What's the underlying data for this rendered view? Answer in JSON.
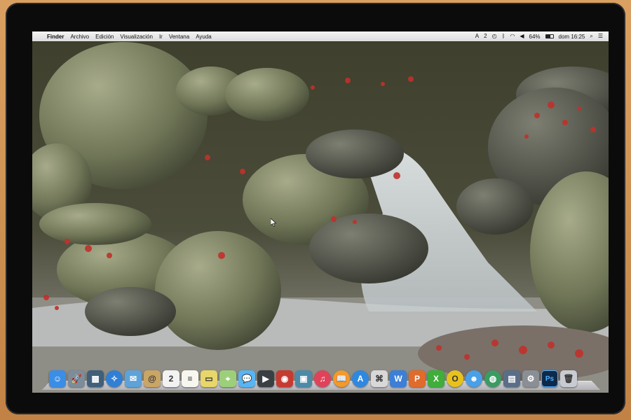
{
  "menubar": {
    "apple": "",
    "app_name": "Finder",
    "menus": [
      "Archivo",
      "Edición",
      "Visualización",
      "Ir",
      "Ventana",
      "Ayuda"
    ],
    "status": {
      "user_count": "2",
      "battery_percent": "64%",
      "battery_level": 0.64,
      "clock": "dom 16:25"
    }
  },
  "dock": {
    "items": [
      {
        "name": "finder",
        "glyph": "☺",
        "color": "#3a8ee6"
      },
      {
        "name": "launchpad",
        "glyph": "🚀",
        "color": "#7d8c99"
      },
      {
        "name": "mission-control",
        "glyph": "▦",
        "color": "#3f5f7a"
      },
      {
        "name": "safari",
        "glyph": "✧",
        "color": "#2f7fd6"
      },
      {
        "name": "photo",
        "glyph": "✉",
        "color": "#5da3d9"
      },
      {
        "name": "contacts",
        "glyph": "@",
        "color": "#c9a566"
      },
      {
        "name": "calendar",
        "glyph": "2",
        "color": "#f2f2f2"
      },
      {
        "name": "notes",
        "glyph": "≡",
        "color": "#f7f7f0"
      },
      {
        "name": "stickies",
        "glyph": "▭",
        "color": "#e7d66a"
      },
      {
        "name": "maps",
        "glyph": "⌖",
        "color": "#9ccf7a"
      },
      {
        "name": "messages",
        "glyph": "💬",
        "color": "#58b4f2"
      },
      {
        "name": "facetime",
        "glyph": "▶",
        "color": "#3a3f44"
      },
      {
        "name": "photo-booth",
        "glyph": "◉",
        "color": "#c63a32"
      },
      {
        "name": "iphoto",
        "glyph": "▣",
        "color": "#4d8aa8"
      },
      {
        "name": "itunes",
        "glyph": "♫",
        "color": "#e0425a"
      },
      {
        "name": "ibooks",
        "glyph": "📖",
        "color": "#f29a2a"
      },
      {
        "name": "app-store",
        "glyph": "A",
        "color": "#2f88e0"
      },
      {
        "name": "preview",
        "glyph": "⌘",
        "color": "#d8d8d8"
      },
      {
        "name": "word",
        "glyph": "W",
        "color": "#3c7fd6"
      },
      {
        "name": "powerpoint",
        "glyph": "P",
        "color": "#e06b2a"
      },
      {
        "name": "excel",
        "glyph": "X",
        "color": "#3fae3a"
      },
      {
        "name": "outlook",
        "glyph": "O",
        "color": "#e8c21c"
      },
      {
        "name": "messenger",
        "glyph": "☻",
        "color": "#4aa0e6"
      },
      {
        "name": "globe",
        "glyph": "◍",
        "color": "#3a9c62"
      },
      {
        "name": "image-app",
        "glyph": "▤",
        "color": "#5a6e88"
      },
      {
        "name": "system-preferences",
        "glyph": "⚙",
        "color": "#8a8f96"
      },
      {
        "name": "photoshop",
        "glyph": "Ps",
        "color": "#0e2a4a"
      },
      {
        "name": "trash",
        "glyph": "🗑",
        "color": "#c8ccd2"
      }
    ]
  }
}
